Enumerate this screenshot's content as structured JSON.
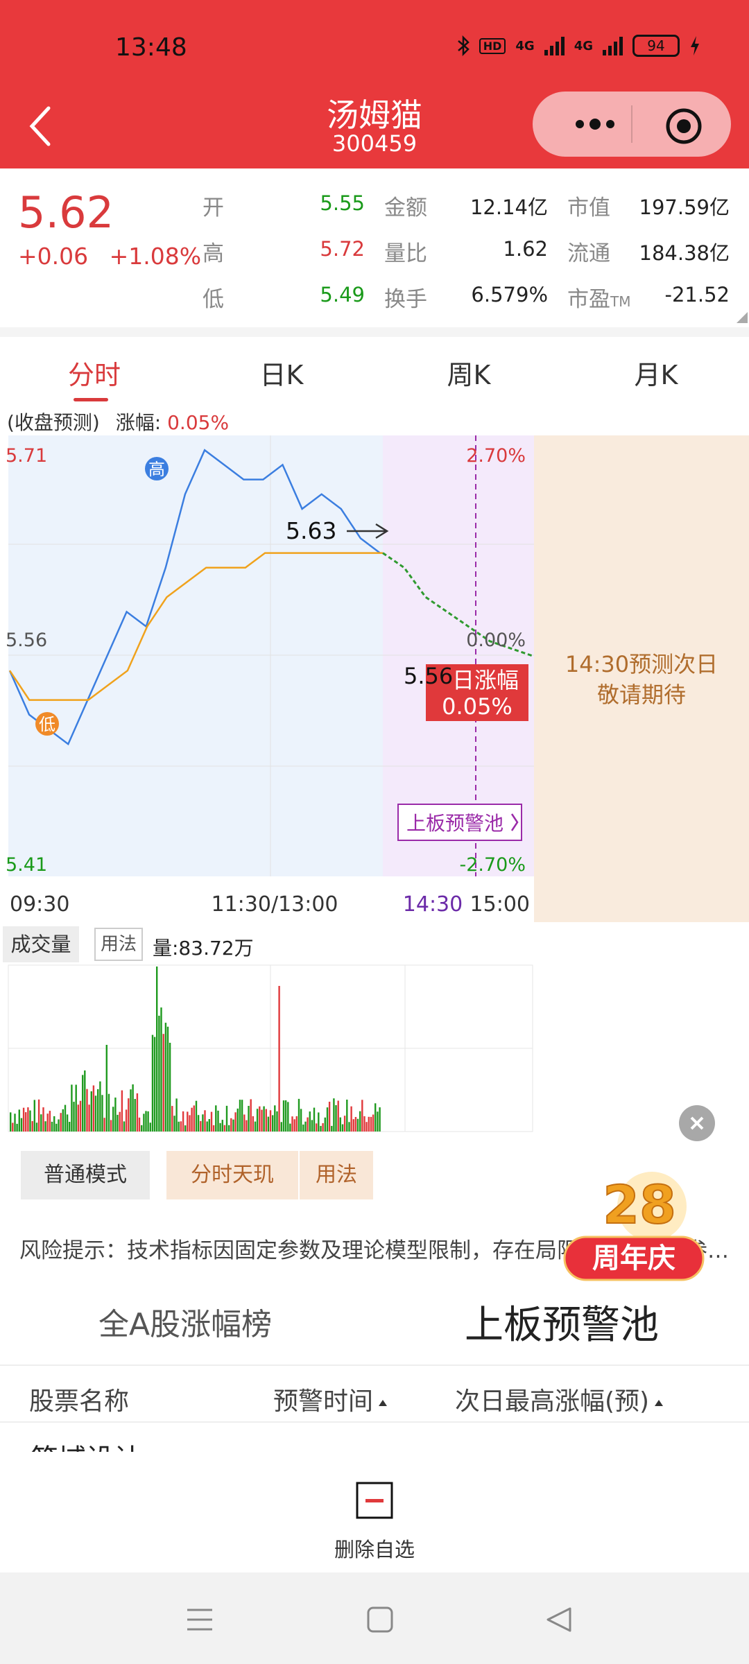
{
  "status": {
    "time": "13:48",
    "network1": "4G",
    "network2": "4G",
    "battery": "94",
    "hd": "HD"
  },
  "title": {
    "name": "汤姆猫",
    "code": "300459"
  },
  "quote": {
    "price": "5.62",
    "change": "+0.06",
    "change_pct": "+1.08%",
    "open_label": "开",
    "open": "5.55",
    "high_label": "高",
    "high": "5.72",
    "low_label": "低",
    "low": "5.49",
    "amount_label": "金额",
    "amount": "12.14亿",
    "ratio_label": "量比",
    "ratio": "1.62",
    "turnover_label": "换手",
    "turnover": "6.579%",
    "mktcap_label": "市值",
    "mktcap": "197.59亿",
    "float_label": "流通",
    "float": "184.38亿",
    "pe_label": "市盈",
    "pe_sup": "TM",
    "pe": "-21.52"
  },
  "tabs": {
    "t1": "分时",
    "t2": "日K",
    "t3": "周K",
    "t4": "月K"
  },
  "chart": {
    "forecast_label": "(收盘预测)",
    "rise_label": "涨幅:",
    "rise_value": "0.05%",
    "y_top": "5.71",
    "y_mid": "5.56",
    "y_bottom": "5.41",
    "pct_top": "2.70%",
    "pct_mid": "0.00%",
    "pct_bottom": "-2.70%",
    "x_start": "09:30",
    "x_mid": "11:30/13:00",
    "x_forecast": "14:30",
    "x_end": "15:00",
    "high_marker": "高",
    "low_marker": "低",
    "price_callout_1": "5.63",
    "price_callout_2": "5.56",
    "next_day_label": "日涨幅",
    "next_day_value": "0.05%",
    "pool_button": "上板预警池",
    "forecast_panel_line1": "14:30预测次日",
    "forecast_panel_line2": "敬请期待",
    "colors": {
      "price": "#3b7ee0",
      "avg": "#f0a21c",
      "forecast": "#2f9a2f",
      "marker": "#9a2aa8"
    }
  },
  "chart_data": {
    "type": "line",
    "title": "",
    "xlabel": "",
    "ylabel": "",
    "x_ticks": [
      "09:30",
      "11:30/13:00",
      "15:00"
    ],
    "ylim": [
      5.41,
      5.71
    ],
    "series": [
      {
        "values": [
          5.55,
          5.52,
          5.51,
          5.5,
          5.53,
          5.56,
          5.59,
          5.58,
          5.62,
          5.67,
          5.7,
          5.69,
          5.68,
          5.68,
          5.69,
          5.66,
          5.67,
          5.66,
          5.64,
          5.63
        ]
      },
      {
        "values": [
          5.55,
          5.53,
          5.53,
          5.53,
          5.53,
          5.54,
          5.55,
          5.58,
          5.6,
          5.61,
          5.62,
          5.62,
          5.62,
          5.63,
          5.63,
          5.63,
          5.63,
          5.63,
          5.63,
          5.63
        ]
      },
      {
        "values": [
          5.63,
          5.62,
          5.6,
          5.59,
          5.58,
          5.57,
          5.565,
          5.56
        ]
      }
    ],
    "volume": {
      "label": "成交量",
      "usage": "用法",
      "amount": "量:83.72万"
    }
  },
  "modes": {
    "normal": "普通模式",
    "fenshi": "分时天玑",
    "usage": "用法"
  },
  "risk": "风险提示：技术指标因固定参数及理论模型限制，存在局限性，请谨慎参考，注意风险。",
  "badge": {
    "number": "28",
    "text": "周年庆"
  },
  "list": {
    "tab1": "全A股涨幅榜",
    "tab2": "上板预警池",
    "col1": "股票名称",
    "col2": "预警时间",
    "col3": "次日最高涨幅(预)",
    "row1_partial": "答域设计"
  },
  "bottom": {
    "delete_label": "删除自选"
  }
}
